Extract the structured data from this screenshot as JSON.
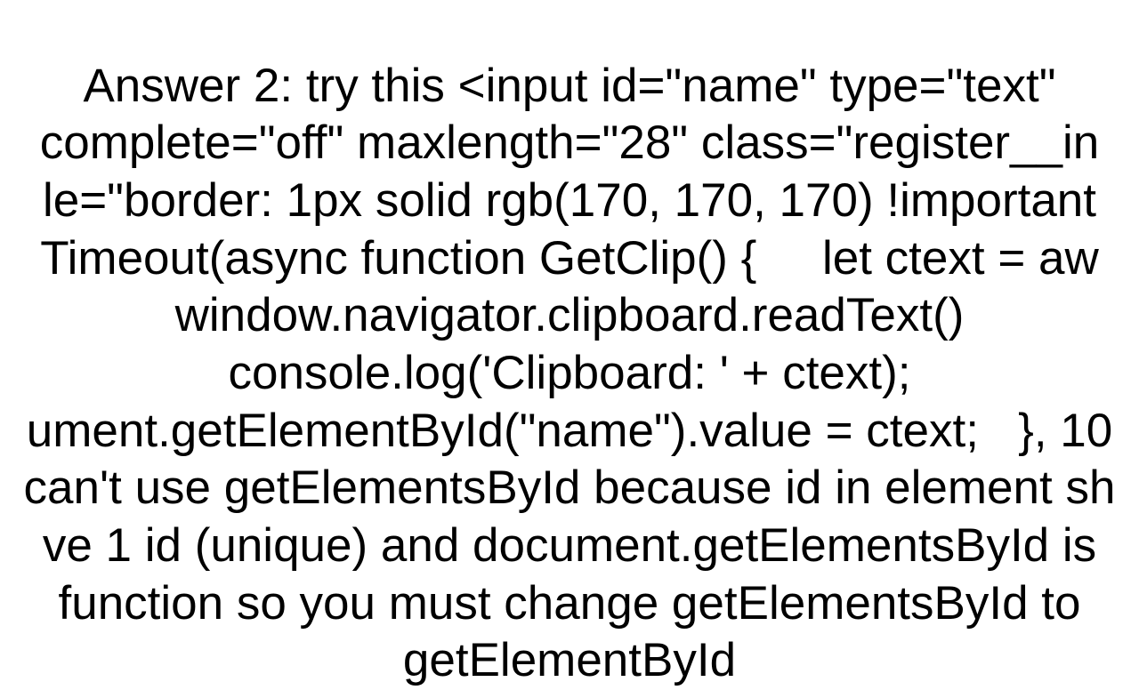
{
  "answer": {
    "label": "Answer 2:",
    "lines": [
      "Answer 2: try this <input id=\"name\" type=\"text\"",
      "complete=\"off\" maxlength=\"28\" class=\"register__in",
      "le=\"border: 1px solid rgb(170, 170, 170) !important",
      "Timeout(async function GetClip() {     let ctext = aw",
      "window.navigator.clipboard.readText()",
      "console.log('Clipboard: ' + ctext);",
      "ument.getElementById(\"name\").value = ctext;   }, 10",
      "can't use getElementsById because id in element sh",
      "ve 1 id (unique) and document.getElementsById is",
      "function so you must change getElementsById to",
      "getElementById"
    ]
  }
}
